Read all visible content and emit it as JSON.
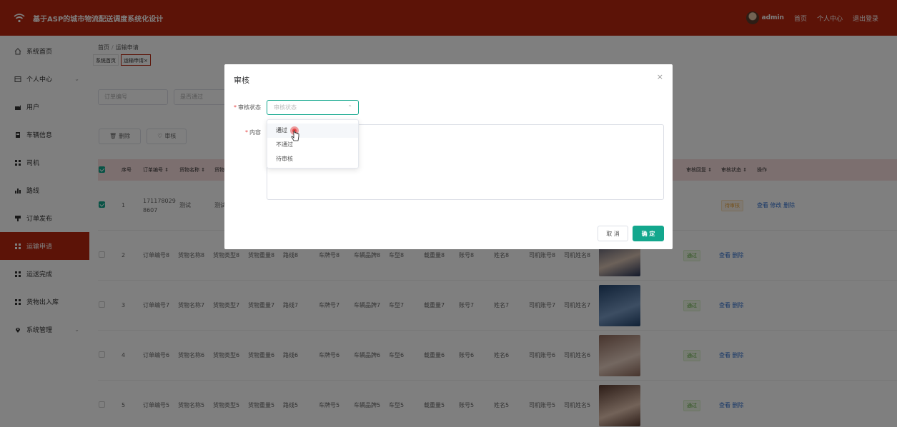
{
  "app": {
    "title": "基于ASP的城市物流配送调度系统化设计"
  },
  "header": {
    "username": "admin",
    "links": [
      "首页",
      "个人中心",
      "退出登录"
    ]
  },
  "sidebar": {
    "items": [
      {
        "label": "系统首页",
        "icon": "home-icon"
      },
      {
        "label": "个人中心",
        "icon": "profile-icon",
        "expandable": true
      },
      {
        "label": "用户",
        "icon": "user-icon"
      },
      {
        "label": "车辆信息",
        "icon": "vehicle-icon"
      },
      {
        "label": "司机",
        "icon": "grid-icon"
      },
      {
        "label": "路线",
        "icon": "bar-chart-icon"
      },
      {
        "label": "订单发布",
        "icon": "order-icon"
      },
      {
        "label": "运输申请",
        "icon": "grid-icon",
        "active": true
      },
      {
        "label": "运送完成",
        "icon": "grid-icon"
      },
      {
        "label": "货物出入库",
        "icon": "grid-icon"
      },
      {
        "label": "系统管理",
        "icon": "location-icon",
        "expandable": true
      }
    ]
  },
  "breadcrumb": {
    "home": "首页",
    "current": "运输申请"
  },
  "tabs": [
    {
      "label": "系统首页"
    },
    {
      "label": "运输申请",
      "close": "×"
    }
  ],
  "search": {
    "order_placeholder": "订单编号",
    "status_placeholder": "是否通过"
  },
  "toolbar": {
    "delete_label": "删除",
    "review_label": "审核"
  },
  "table": {
    "headers": {
      "index": "序号",
      "order_no": "订单编号",
      "goods_name": "货物名称",
      "goods_type": "货物",
      "review_reply": "审核回复",
      "review_status": "审核状态",
      "actions": "操作"
    },
    "rows": [
      {
        "index": "1",
        "order_no": "1711780298607",
        "goods_name": "测试",
        "goods_type": "测试",
        "status": "待审核",
        "status_kind": "pending",
        "actions": [
          "查看",
          "修改",
          "删除"
        ],
        "checked": true
      },
      {
        "index": "2",
        "cells": [
          "订单编号8",
          "货物名称8",
          "货物类型8",
          "货物重量8",
          "路线8",
          "车牌号8",
          "车辆品牌8",
          "车型8",
          "载重量8",
          "账号8",
          "姓名8",
          "司机账号8",
          "司机姓名8"
        ],
        "status": "通过",
        "status_kind": "pass",
        "actions": [
          "查看",
          "删除"
        ]
      },
      {
        "index": "3",
        "cells": [
          "订单编号7",
          "货物名称7",
          "货物类型7",
          "货物重量7",
          "路线7",
          "车牌号7",
          "车辆品牌7",
          "车型7",
          "载重量7",
          "账号7",
          "姓名7",
          "司机账号7",
          "司机姓名7"
        ],
        "status": "通过",
        "status_kind": "pass",
        "actions": [
          "查看",
          "删除"
        ]
      },
      {
        "index": "4",
        "cells": [
          "订单编号6",
          "货物名称6",
          "货物类型6",
          "货物重量6",
          "路线6",
          "车牌号6",
          "车辆品牌6",
          "车型6",
          "载重量6",
          "账号6",
          "姓名6",
          "司机账号6",
          "司机姓名6"
        ],
        "status": "通过",
        "status_kind": "pass",
        "actions": [
          "查看",
          "删除"
        ]
      },
      {
        "index": "5",
        "cells": [
          "订单编号5",
          "货物名称5",
          "货物类型5",
          "货物重量5",
          "路线5",
          "车牌号5",
          "车辆品牌5",
          "车型5",
          "载重量5",
          "账号5",
          "姓名5",
          "司机账号5",
          "司机姓名5"
        ],
        "status": "通过",
        "status_kind": "pass",
        "actions": [
          "查看",
          "删除"
        ]
      }
    ]
  },
  "dialog": {
    "title": "审核",
    "close": "×",
    "status_label": "审核状态",
    "status_placeholder": "审核状态",
    "content_label": "内容",
    "cancel_label": "取 消",
    "ok_label": "确 定",
    "options": [
      "通过",
      "不通过",
      "待审核"
    ]
  },
  "colors": {
    "brand": "#b8270f",
    "accent": "#13a78d",
    "link": "#2f6fcf"
  }
}
